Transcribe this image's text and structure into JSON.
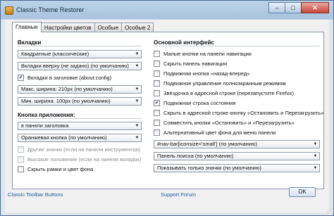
{
  "window": {
    "title": "Classic Theme Restorer",
    "minimize_glyph": "‒",
    "maximize_glyph": "□",
    "close_glyph": "✕"
  },
  "tabs": [
    "Главные",
    "Настройки цветов",
    "Особые",
    "Особые 2"
  ],
  "left": {
    "tabs_section": {
      "title": "Вкладки",
      "combo1": "Квадратные (классические)",
      "combo2": "Вкладки вверху (не задано) (по умолчанию)",
      "checkbox_tabs_in_title": {
        "label": "Вкладки в заголовке (about:config)",
        "checked": true
      },
      "combo_max_width": "Макс. ширина: 210px (по умолчанию)",
      "combo_min_width": "Мин. ширина: 100px (по умолчанию)"
    },
    "app_button_section": {
      "title": "Кнопка приложения:",
      "combo_location": "в панели заголовка",
      "combo_style": "Оранжевая кнопка (по умолчанию)",
      "checkboxes": [
        {
          "label": "Другие значки (если на панели инструментов)",
          "checked": false,
          "disabled": true
        },
        {
          "label": "Высокое положение (если на панели вкладок)",
          "checked": false,
          "disabled": true
        },
        {
          "label": "Скрыть рамки и цвет фона",
          "checked": false,
          "disabled": false
        }
      ]
    }
  },
  "right": {
    "title": "Основной интерфейс",
    "checkboxes": [
      {
        "label": "Малые кнопки на панели навигации",
        "checked": false
      },
      {
        "label": "Скрыть панель навигации",
        "checked": false
      },
      {
        "label": "Подвижная кнопка «назад-вперед»",
        "checked": false
      },
      {
        "label": "Подвижное управление полноэкранным режимом",
        "checked": false
      },
      {
        "label": "Звёздочка в адресной строке (перезапустите Firefox)",
        "checked": false
      },
      {
        "label": "Подвижная строка состояния",
        "checked": true
      },
      {
        "label": "Скрыть в адресной строке кнопку «Остановить и Перезагрузить»",
        "checked": false
      },
      {
        "label": "Совместить кнопки «Остановить» и «Перезагрузить»",
        "checked": false
      },
      {
        "label": "Альтернативный цвет фона для меню панели",
        "checked": false
      }
    ],
    "combo_navbar": "#nav-bar[iconsize='small'] (по умолчанию)",
    "combo_searchbar": "Панель поиска (по умолчанию)",
    "combo_icons": "Показывать только значки (по умолчанию)"
  },
  "footer": {
    "link_left": "Classic Toolbar Buttons",
    "link_center": "Support Forum",
    "ok_label": "OK",
    "resize_grip": "⋰"
  },
  "glyphs": {
    "check": "✔",
    "dropdown": "▼"
  }
}
